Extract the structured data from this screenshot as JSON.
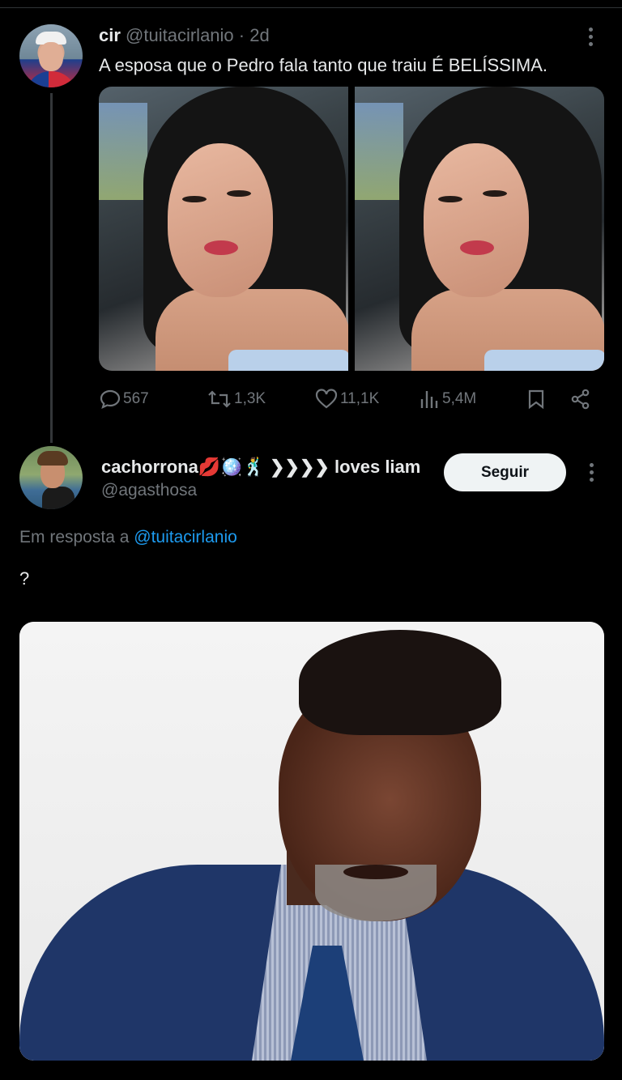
{
  "tweet": {
    "display_name": "cir",
    "handle": "@tuitacirlanio",
    "age": "· 2d",
    "text": "A esposa que o Pedro fala tanto que traiu É BELÍSSIMA.",
    "stats": {
      "replies": "567",
      "retweets": "1,3K",
      "likes": "11,1K",
      "views": "5,4M"
    }
  },
  "reply": {
    "display_name": "cachorrona💋🪩🕺 ❯❯❯❯ loves liam",
    "handle": "@agasthosa",
    "follow_label": "Seguir",
    "replying_prefix": "Em resposta a",
    "replying_to": "@tuitacirlanio",
    "text": "?"
  },
  "colors": {
    "background": "#000000",
    "text": "#e7e9ea",
    "muted": "#71767b",
    "link": "#1d9bf0",
    "follow_button_bg": "#eff3f4"
  }
}
